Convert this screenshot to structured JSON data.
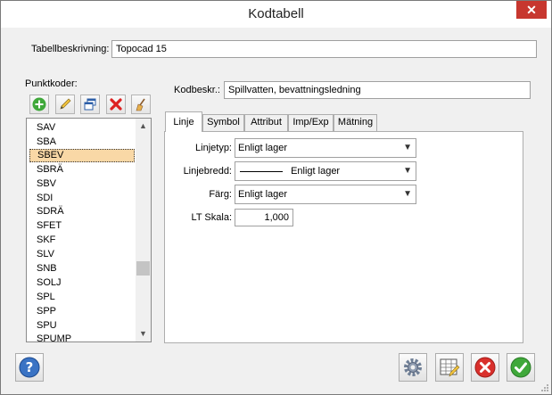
{
  "window": {
    "title": "Kodtabell",
    "close_glyph": "✕"
  },
  "description": {
    "label": "Tabellbeskrivning:",
    "value": "Topocad 15"
  },
  "punktkoder": {
    "label": "Punktkoder:",
    "toolbar": [
      "add-icon",
      "pencil-edit-icon",
      "copy-windows-icon",
      "delete-x-icon",
      "broom-clean-icon"
    ],
    "items": [
      "SAV",
      "SBA",
      "SBEV",
      "SBRÄ",
      "SBV",
      "SDI",
      "SDRÄ",
      "SFET",
      "SKF",
      "SLV",
      "SNB",
      "SOLJ",
      "SPL",
      "SPP",
      "SPU",
      "SPUMP"
    ],
    "selected": "SBEV"
  },
  "code_description": {
    "label": "Kodbeskr.:",
    "value": "Spillvatten, bevattningsledning"
  },
  "tabs": [
    {
      "label": "Linje",
      "active": true
    },
    {
      "label": "Symbol",
      "active": false
    },
    {
      "label": "Attribut",
      "active": false
    },
    {
      "label": "Imp/Exp",
      "active": false
    },
    {
      "label": "Mätning",
      "active": false
    }
  ],
  "linje": {
    "linjetyp": {
      "label": "Linjetyp:",
      "value": "Enligt lager"
    },
    "linjebredd": {
      "label": "Linjebredd:",
      "value": "Enligt lager"
    },
    "farg": {
      "label": "Färg:",
      "value": "Enligt lager"
    },
    "lt_skala": {
      "label": "LT Skala:",
      "value": "1,000"
    }
  },
  "buttons": [
    "help-icon",
    "settings-gear-icon",
    "table-edit-icon",
    "cancel-icon",
    "ok-check-icon"
  ],
  "colors": {
    "selected_item": "#f9d8a6",
    "close_button": "#c7372f",
    "cancel": "#d9302c",
    "ok": "#3fa83a",
    "help": "#3a73c4"
  }
}
